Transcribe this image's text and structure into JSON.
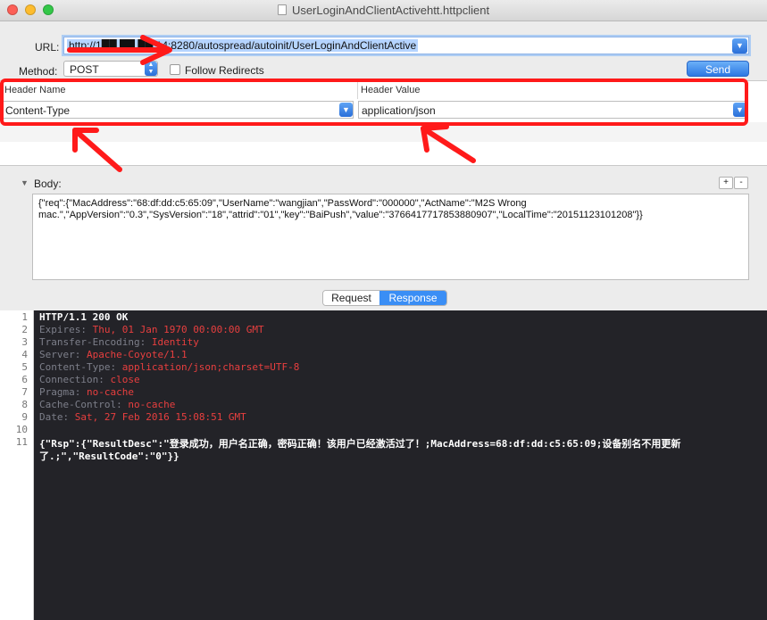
{
  "window": {
    "title": "UserLoginAndClientActivehtt.httpclient"
  },
  "request": {
    "url_label": "URL:",
    "url_value": "http://1██.██.██.14:8280/autospread/autoinit/UserLoginAndClientActive",
    "method_label": "Method:",
    "method_value": "POST",
    "follow_redirects_label": "Follow Redirects",
    "follow_redirects_checked": false,
    "send_label": "Send"
  },
  "headers": {
    "name_column": "Header Name",
    "value_column": "Header Value",
    "rows": [
      {
        "name": "Content-Type",
        "value": "application/json"
      }
    ]
  },
  "body": {
    "label": "Body:",
    "add_label": "+",
    "remove_label": "-",
    "content_line1": "{\"req\":{\"MacAddress\":\"68:df:dd:c5:65:09\",\"UserName\":\"wangjian\",\"PassWord\":\"000000\",\"ActName\":\"M2S Wrong",
    "content_line2": "mac.\",\"AppVersion\":\"0.3\",\"SysVersion\":\"18\",\"attrid\":\"01\",\"key\":\"BaiPush\",\"value\":\"3766417717853880907\",\"LocalTime\":\"20151123101208\"}}"
  },
  "tabs": {
    "request": "Request",
    "response": "Response",
    "selected": "Response"
  },
  "response": {
    "line_numbers": [
      "1",
      "2",
      "3",
      "4",
      "5",
      "6",
      "7",
      "8",
      "9",
      "10",
      "11"
    ],
    "status": "HTTP/1.1 200 OK",
    "headers": [
      {
        "key": "Expires: ",
        "value": "Thu, 01 Jan 1970 00:00:00 GMT"
      },
      {
        "key": "Transfer-Encoding: ",
        "value": "Identity"
      },
      {
        "key": "Server: ",
        "value": "Apache-Coyote/1.1"
      },
      {
        "key": "Content-Type: ",
        "value": "application/json;charset=UTF-8"
      },
      {
        "key": "Connection: ",
        "value": "close"
      },
      {
        "key": "Pragma: ",
        "value": "no-cache"
      },
      {
        "key": "Cache-Control: ",
        "value": "no-cache"
      },
      {
        "key": "Date: ",
        "value": "Sat, 27 Feb 2016 15:08:51 GMT"
      }
    ],
    "body_line1": "{\"Rsp\":{\"ResultDesc\":\"登录成功，用户名正确，密码正确！该用户已经激活过了！;MacAddress=68:df:dd:c5:65:09;设备别名不用更新",
    "body_line2": "了.;\",\"ResultCode\":\"0\"}}"
  },
  "colors": {
    "accent": "#3a8ef5",
    "annotation": "#ff1a1a",
    "console_bg": "#232328",
    "header_key": "#7d7f8a",
    "header_value": "#e83f3f"
  },
  "icons": [
    "close-light",
    "minimize-light",
    "zoom-light",
    "document-icon",
    "chevron-down-icon",
    "stepper-icon",
    "disclosure-triangle-icon",
    "annotation-arrow"
  ]
}
